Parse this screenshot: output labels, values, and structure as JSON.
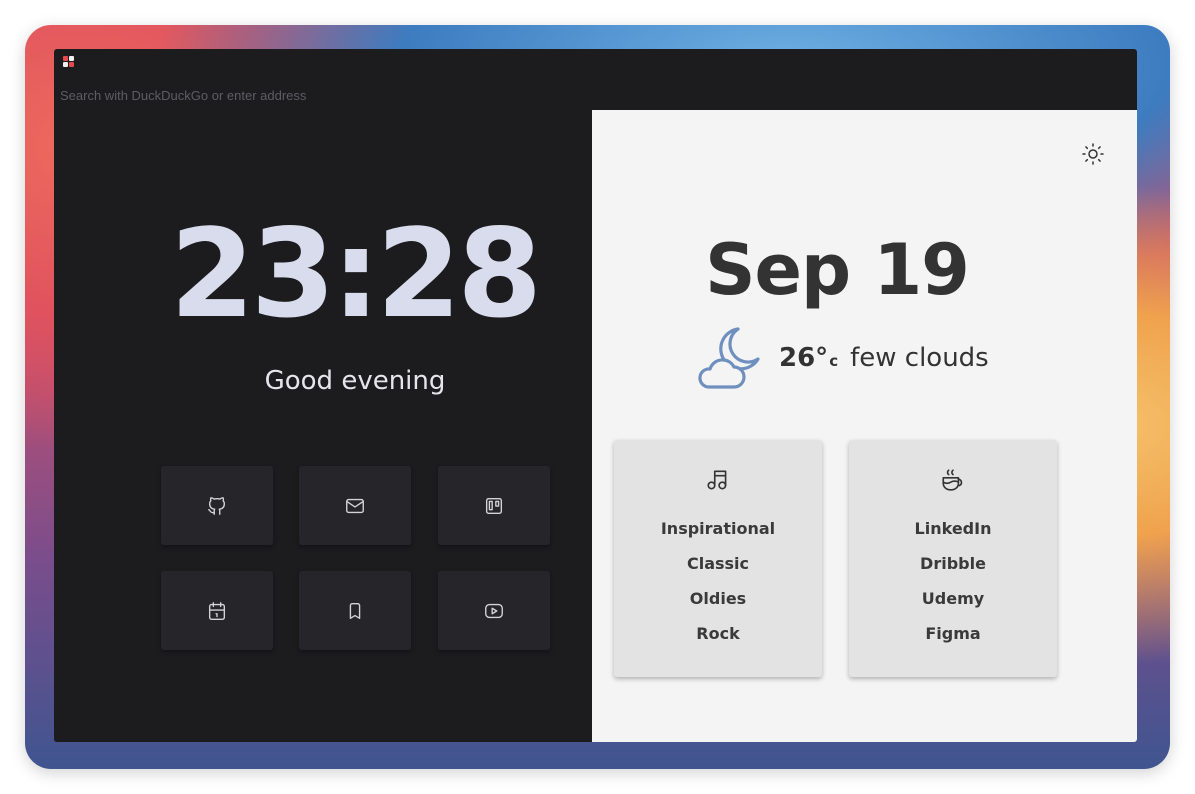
{
  "browser": {
    "address_placeholder": "Search with DuckDuckGo or enter address"
  },
  "clock": {
    "time": "23:28",
    "greeting": "Good evening"
  },
  "shortcuts": [
    {
      "icon": "github-icon"
    },
    {
      "icon": "mail-icon"
    },
    {
      "icon": "trello-icon"
    },
    {
      "icon": "calendar-icon"
    },
    {
      "icon": "bookmark-icon"
    },
    {
      "icon": "youtube-icon"
    }
  ],
  "date": {
    "text": "Sep 19"
  },
  "weather": {
    "temperature": "26°",
    "unit": "c",
    "condition": "few clouds",
    "icon": "moon-cloud-icon"
  },
  "cards": [
    {
      "icon": "music-note-icon",
      "links": [
        "Inspirational",
        "Classic",
        "Oldies",
        "Rock"
      ]
    },
    {
      "icon": "coffee-cup-icon",
      "links": [
        "LinkedIn",
        "Dribble",
        "Udemy",
        "Figma"
      ]
    }
  ],
  "theme": {
    "toggle_icon": "sun-icon"
  },
  "colors": {
    "dark_pane": "#1c1c1f",
    "light_pane": "#f4f4f4",
    "clock_text": "#d8dcec",
    "weather_icon": "#6f8fbf"
  }
}
